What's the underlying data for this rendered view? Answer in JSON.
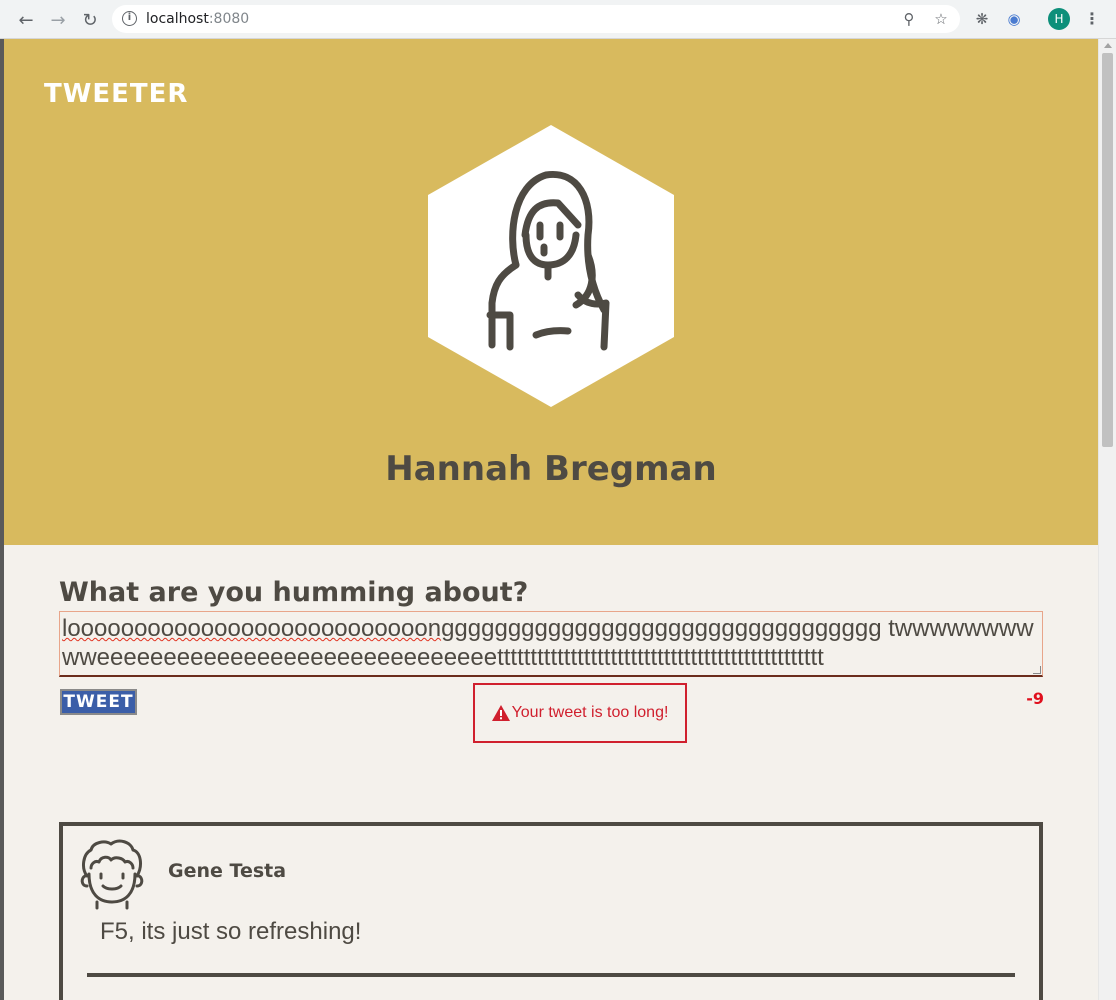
{
  "browser": {
    "url_host": "localhost",
    "url_port": ":8080",
    "profile_initial": "H"
  },
  "app": {
    "brand": "TWEETER"
  },
  "profile": {
    "name": "Hannah Bregman"
  },
  "compose": {
    "prompt": "What are you humming about?",
    "tweet_text_misspelled": "looooooooooooooooooooooooooon",
    "tweet_text_rest": "ggggggggggggggggggggggggggggggggg twwwwwwwwwweeeeeeeeeeeeeeeeeeeeeeeeeeeeeettttttttttttttttttttttttttttttttttttttttttttttttt",
    "submit_label": "TWEET",
    "error_message": "Your tweet is too long!",
    "char_counter": "-9"
  },
  "feed": {
    "tweets": [
      {
        "author": "Gene Testa",
        "text": "F5, its just so refreshing!"
      }
    ]
  },
  "colors": {
    "header_bg": "#d8ba5e",
    "page_bg": "#f4f1ec",
    "text_dark": "#4e4a43",
    "error_red": "#d0202e",
    "button_blue": "#3b5ea8"
  }
}
